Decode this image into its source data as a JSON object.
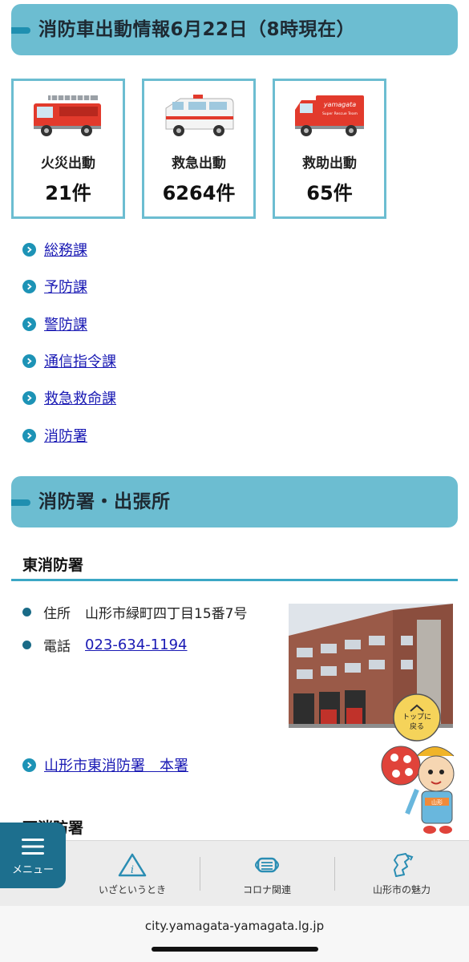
{
  "dispatch": {
    "heading": "消防車出動情報6月22日（8時現在）",
    "stats": [
      {
        "label": "火災出動",
        "count": "21件",
        "icon": "fire-engine-icon"
      },
      {
        "label": "救急出動",
        "count": "6264件",
        "icon": "ambulance-icon"
      },
      {
        "label": "救助出動",
        "count": "65件",
        "icon": "rescue-truck-icon"
      }
    ],
    "rescue_truck_decal": "yamagata",
    "rescue_truck_sub": "Super Rescue Team"
  },
  "departments": [
    "総務課",
    "予防課",
    "警防課",
    "通信指令課",
    "救急救命課",
    "消防署"
  ],
  "stations": {
    "heading": "消防署・出張所",
    "east": {
      "name": "東消防署",
      "address_label": "住所",
      "address": "山形市緑町四丁目15番7号",
      "phone_label": "電話",
      "phone": "023-634-1194",
      "link": "山形市東消防署　本署"
    },
    "west_partial": "西消防署"
  },
  "back_to_top": {
    "line1": "トップに",
    "line2": "戻る"
  },
  "mascot_sash": "山形",
  "menu_button": "メニュー",
  "tabs": [
    {
      "label": "いざというとき",
      "icon": "info-icon"
    },
    {
      "label": "コロナ関連",
      "icon": "mask-icon"
    },
    {
      "label": "山形市の魅力",
      "icon": "yamagata-map-icon"
    }
  ],
  "url": "city.yamagata-yamagata.lg.jp",
  "colors": {
    "header_bg": "#6cbdd1",
    "accent": "#1d93b6",
    "menu_bg": "#1d6f8e",
    "link": "#1a1ab4"
  }
}
